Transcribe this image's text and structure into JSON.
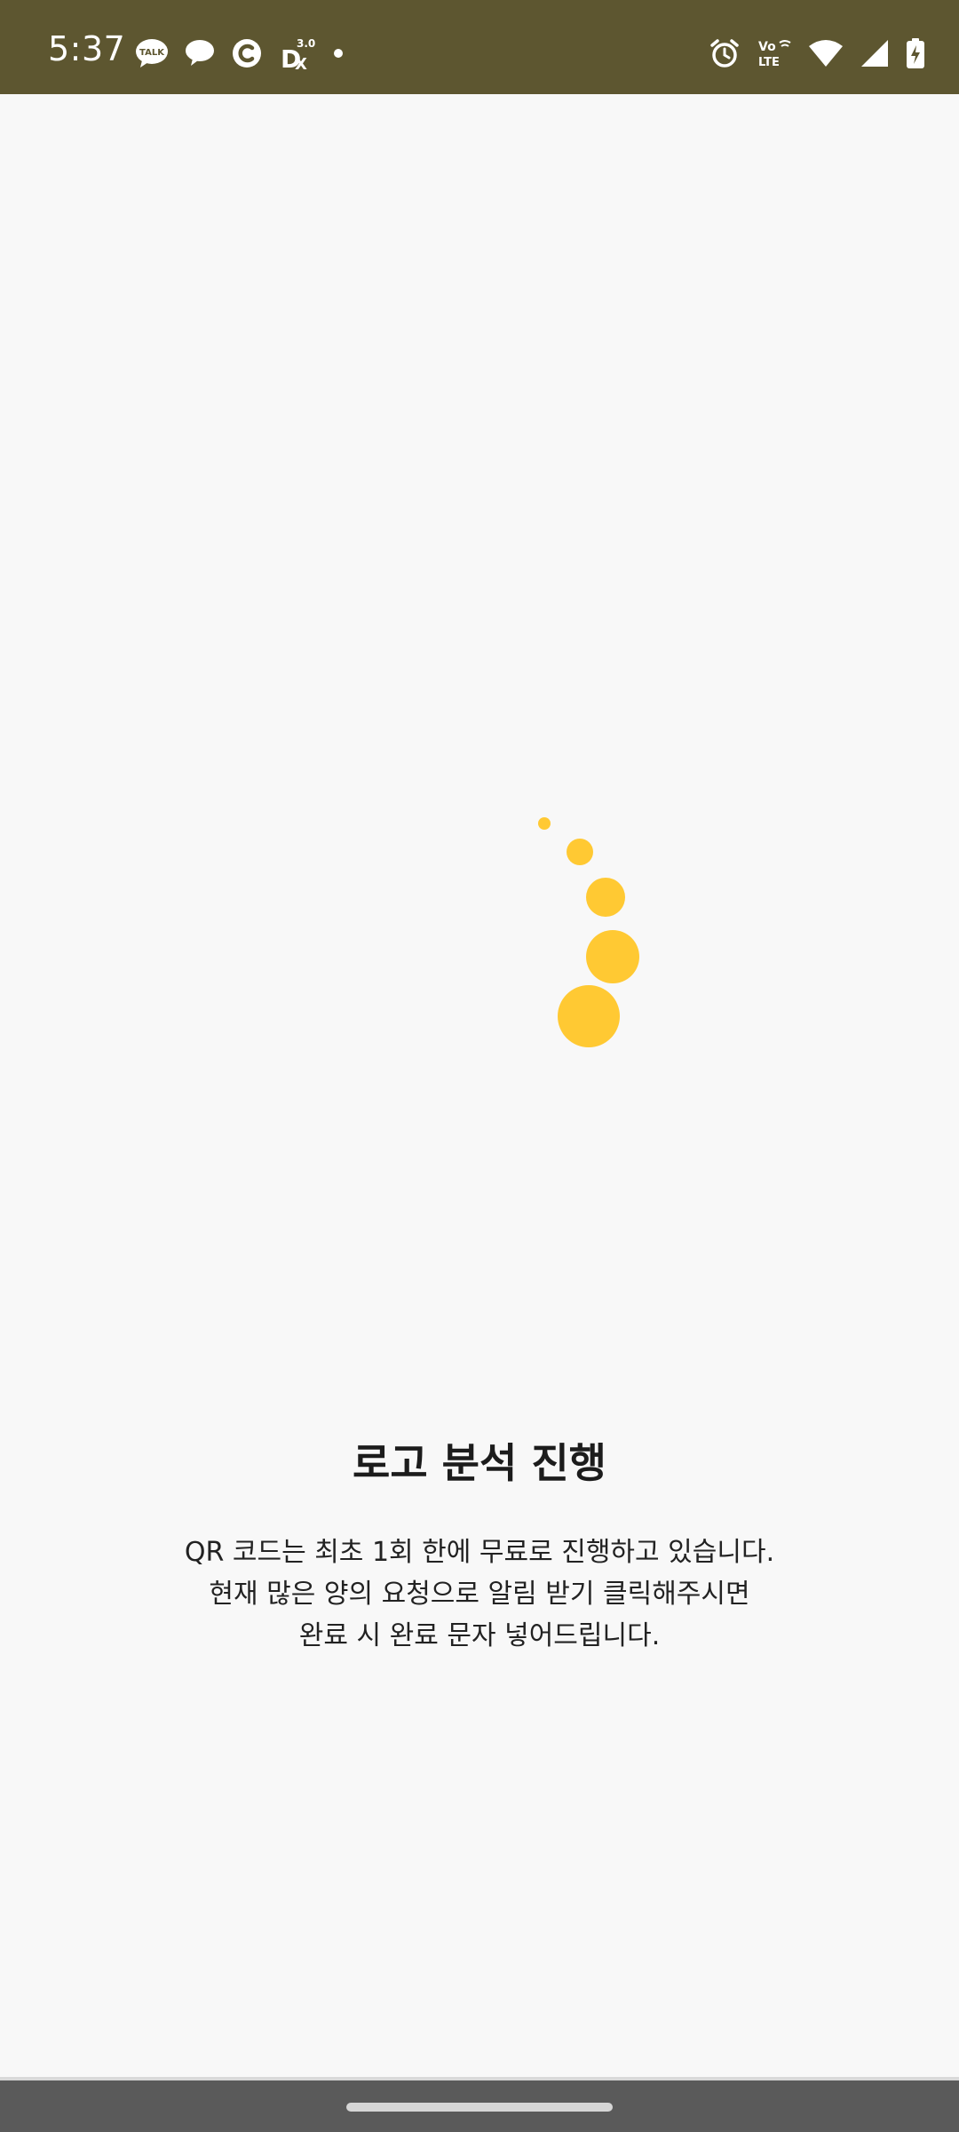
{
  "status_bar": {
    "time": "5:37",
    "notification_icons": [
      "kakaotalk-icon",
      "chat-bubble-icon",
      "c-app-icon",
      "dx-app-icon",
      "dot-icon"
    ],
    "system_icons": [
      "alarm-icon",
      "volte-icon",
      "wifi-icon",
      "signal-icon",
      "battery-icon"
    ],
    "background_color": "#5d5630"
  },
  "loading": {
    "indicator": "loading-dots-icon",
    "color": "#ffc933"
  },
  "content": {
    "title": "로고 분석 진행",
    "description_lines": [
      "QR 코드는 최초 1회 한에 무료로 진행하고 있습니다.",
      "현재 많은 양의 요청으로 알림 받기 클릭해주시면",
      "완료 시 완료 문자 넣어드립니다."
    ]
  }
}
